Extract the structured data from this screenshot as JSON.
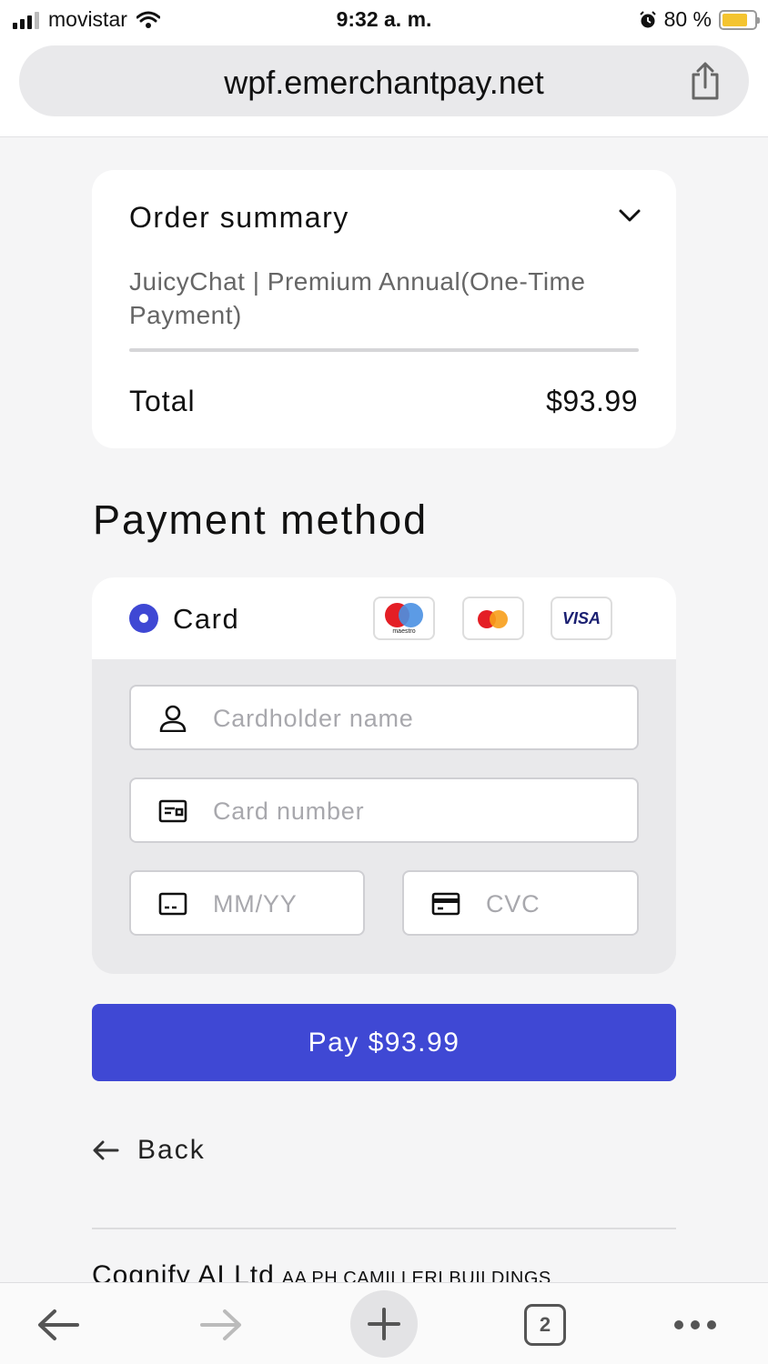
{
  "status_bar": {
    "carrier": "movistar",
    "time": "9:32 a. m.",
    "battery": "80 %",
    "battery_level": 0.8,
    "icons": [
      "signal-icon",
      "wifi-icon",
      "alarm-icon",
      "battery-icon"
    ]
  },
  "browser": {
    "url": "wpf.emerchantpay.net",
    "open_tabs": "2",
    "icons": [
      "share-icon",
      "back-arrow-icon",
      "forward-arrow-icon",
      "plus-icon",
      "tabs-icon",
      "more-icon"
    ]
  },
  "order_summary": {
    "title": "Order summary",
    "item": "JuicyChat | Premium Annual(One-Time Payment)",
    "total_label": "Total",
    "total_value": "$93.99"
  },
  "payment": {
    "title": "Payment method",
    "method_label": "Card",
    "brands": {
      "maestro": "maestro",
      "visa": "VISA"
    },
    "fields": {
      "cardholder_placeholder": "Cardholder name",
      "card_number_placeholder": "Card number",
      "expiry_placeholder": "MM/YY",
      "cvc_placeholder": "CVC"
    },
    "pay_label": "Pay $93.99",
    "accent_color": "#3f48d4"
  },
  "back_label": "Back",
  "footer": {
    "company_name": "Cognify AI Ltd",
    "address": "AA PH CAMILLERI BUILDINGS"
  }
}
